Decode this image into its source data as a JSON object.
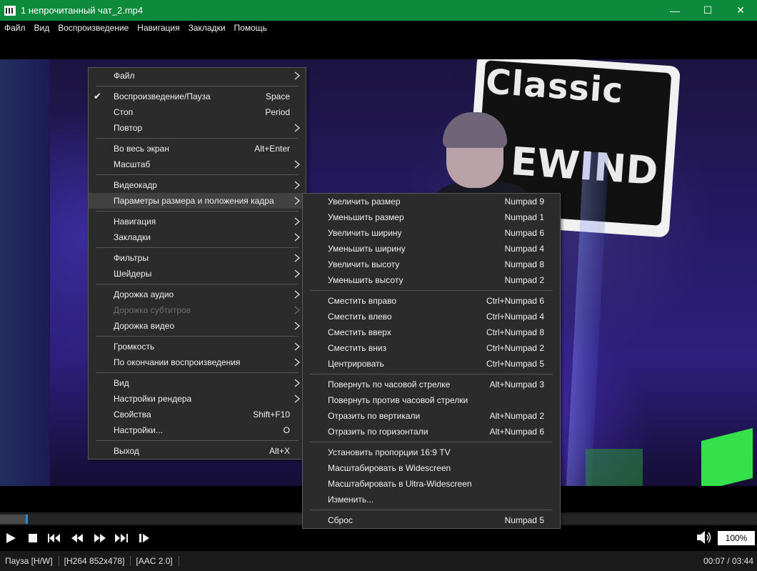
{
  "window": {
    "title": "1 непрочитанный чат_2.mp4",
    "minimize": "—",
    "maximize": "☐",
    "close": "✕"
  },
  "menubar": [
    "Файл",
    "Вид",
    "Воспроизведение",
    "Навигация",
    "Закладки",
    "Помощь"
  ],
  "context_menu": {
    "groups": [
      [
        {
          "label": "Файл",
          "submenu": true
        }
      ],
      [
        {
          "label": "Воспроизведение/Пауза",
          "shortcut": "Space",
          "checked": true
        },
        {
          "label": "Стоп",
          "shortcut": "Period"
        },
        {
          "label": "Повтор",
          "submenu": true
        }
      ],
      [
        {
          "label": "Во весь экран",
          "shortcut": "Alt+Enter"
        },
        {
          "label": "Масштаб",
          "submenu": true
        }
      ],
      [
        {
          "label": "Видеокадр",
          "submenu": true
        },
        {
          "label": "Параметры размера и положения кадра",
          "submenu": true,
          "highlighted": true
        }
      ],
      [
        {
          "label": "Навигация",
          "submenu": true
        },
        {
          "label": "Закладки",
          "submenu": true
        }
      ],
      [
        {
          "label": "Фильтры",
          "submenu": true
        },
        {
          "label": "Шейдеры",
          "submenu": true
        }
      ],
      [
        {
          "label": "Дорожка аудио",
          "submenu": true
        },
        {
          "label": "Дорожка субтитров",
          "submenu": true,
          "disabled": true
        },
        {
          "label": "Дорожка видео",
          "submenu": true
        }
      ],
      [
        {
          "label": "Громкость",
          "submenu": true
        },
        {
          "label": "По окончании воспроизведения",
          "submenu": true
        }
      ],
      [
        {
          "label": "Вид",
          "submenu": true
        },
        {
          "label": "Настройки рендера",
          "submenu": true
        },
        {
          "label": "Свойства",
          "shortcut": "Shift+F10"
        },
        {
          "label": "Настройки...",
          "shortcut": "O"
        }
      ],
      [
        {
          "label": "Выход",
          "shortcut": "Alt+X"
        }
      ]
    ]
  },
  "submenu": {
    "groups": [
      [
        {
          "label": "Увеличить размер",
          "shortcut": "Numpad 9"
        },
        {
          "label": "Уменьшить размер",
          "shortcut": "Numpad 1"
        },
        {
          "label": "Увеличить ширину",
          "shortcut": "Numpad 6"
        },
        {
          "label": "Уменьшить ширину",
          "shortcut": "Numpad 4"
        },
        {
          "label": "Увеличить высоту",
          "shortcut": "Numpad 8"
        },
        {
          "label": "Уменьшить высоту",
          "shortcut": "Numpad 2"
        }
      ],
      [
        {
          "label": "Сместить вправо",
          "shortcut": "Ctrl+Numpad 6"
        },
        {
          "label": "Сместить влево",
          "shortcut": "Ctrl+Numpad 4"
        },
        {
          "label": "Сместить вверх",
          "shortcut": "Ctrl+Numpad 8"
        },
        {
          "label": "Сместить вниз",
          "shortcut": "Ctrl+Numpad 2"
        },
        {
          "label": "Центрировать",
          "shortcut": "Ctrl+Numpad 5"
        }
      ],
      [
        {
          "label": "Повернуть по часовой стрелке",
          "shortcut": "Alt+Numpad 3"
        },
        {
          "label": "Повернуть против часовой стрелки",
          "shortcut": ""
        },
        {
          "label": "Отразить по вертикали",
          "shortcut": "Alt+Numpad 2"
        },
        {
          "label": "Отразить по горизонтали",
          "shortcut": "Alt+Numpad 6"
        }
      ],
      [
        {
          "label": "Установить пропорции 16:9 TV",
          "shortcut": ""
        },
        {
          "label": "Масштабировать в Widescreen",
          "shortcut": ""
        },
        {
          "label": "Масштабировать в Ultra-Widescreen",
          "shortcut": ""
        },
        {
          "label": "Изменить...",
          "shortcut": ""
        }
      ],
      [
        {
          "label": "Сброс",
          "shortcut": "Numpad 5"
        }
      ]
    ]
  },
  "video": {
    "sign_line1": "Classic",
    "sign_line2": "EWIND"
  },
  "seek": {
    "progress": 0.034
  },
  "zoom": "100%",
  "status": {
    "state": "Пауза [H/W]",
    "video": "[H264 852x478]",
    "audio": "[AAC 2.0]",
    "time": "00:07 / 03:44"
  },
  "colors": {
    "titlebar": "#0e8a3c",
    "menu_bg": "#2b2b2b",
    "seek_handle": "#2b8fe0"
  },
  "icons": [
    "play-icon",
    "stop-icon",
    "previous-icon",
    "rewind-icon",
    "fast-forward-icon",
    "next-icon",
    "frame-step-icon",
    "volume-icon",
    "submenu-arrow-icon",
    "check-icon"
  ]
}
